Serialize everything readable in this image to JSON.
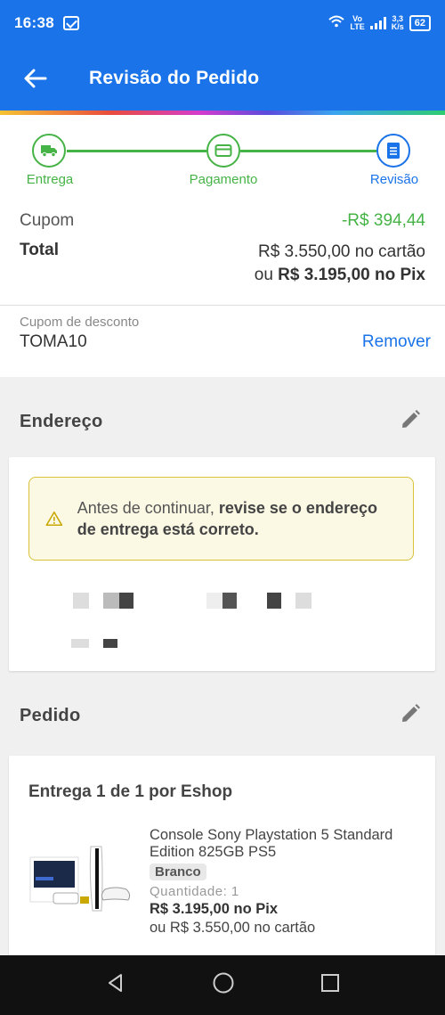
{
  "status": {
    "time": "16:38",
    "volte_top": "Vo",
    "volte_bottom": "LTE",
    "speed_top": "3,3",
    "speed_bottom": "K/s",
    "battery": "62"
  },
  "header": {
    "title": "Revisão do Pedido"
  },
  "steps": [
    {
      "label": "Entrega",
      "icon": "truck-icon"
    },
    {
      "label": "Pagamento",
      "icon": "card-icon"
    },
    {
      "label": "Revisão",
      "icon": "document-icon"
    }
  ],
  "summary": {
    "cupom_label": "Cupom",
    "cupom_value": "-R$ 394,44",
    "total_label": "Total",
    "total_card": "R$ 3.550,00 no cartão",
    "total_pix_prefix": "ou",
    "total_pix": "R$ 3.195,00 no Pix"
  },
  "coupon": {
    "label": "Cupom de desconto",
    "code": "TOMA10",
    "remove": "Remover"
  },
  "address": {
    "heading": "Endereço",
    "warning_prefix": "Antes de continuar,",
    "warning_bold": "revise se o endereço de entrega está correto."
  },
  "order": {
    "heading": "Pedido",
    "delivery": "Entrega 1 de 1 por Eshop",
    "product_name": "Console Sony Playstation 5 Standard Edition 825GB PS5",
    "variant": "Branco",
    "quantity": "Quantidade:  1",
    "price_pix": "R$ 3.195,00 no Pix",
    "price_card": "ou R$ 3.550,00 no cartão"
  },
  "colors": {
    "primary": "#1a73e8",
    "success": "#46b347",
    "warning_border": "#d9c23a",
    "warning_bg": "#fbf8e4"
  }
}
